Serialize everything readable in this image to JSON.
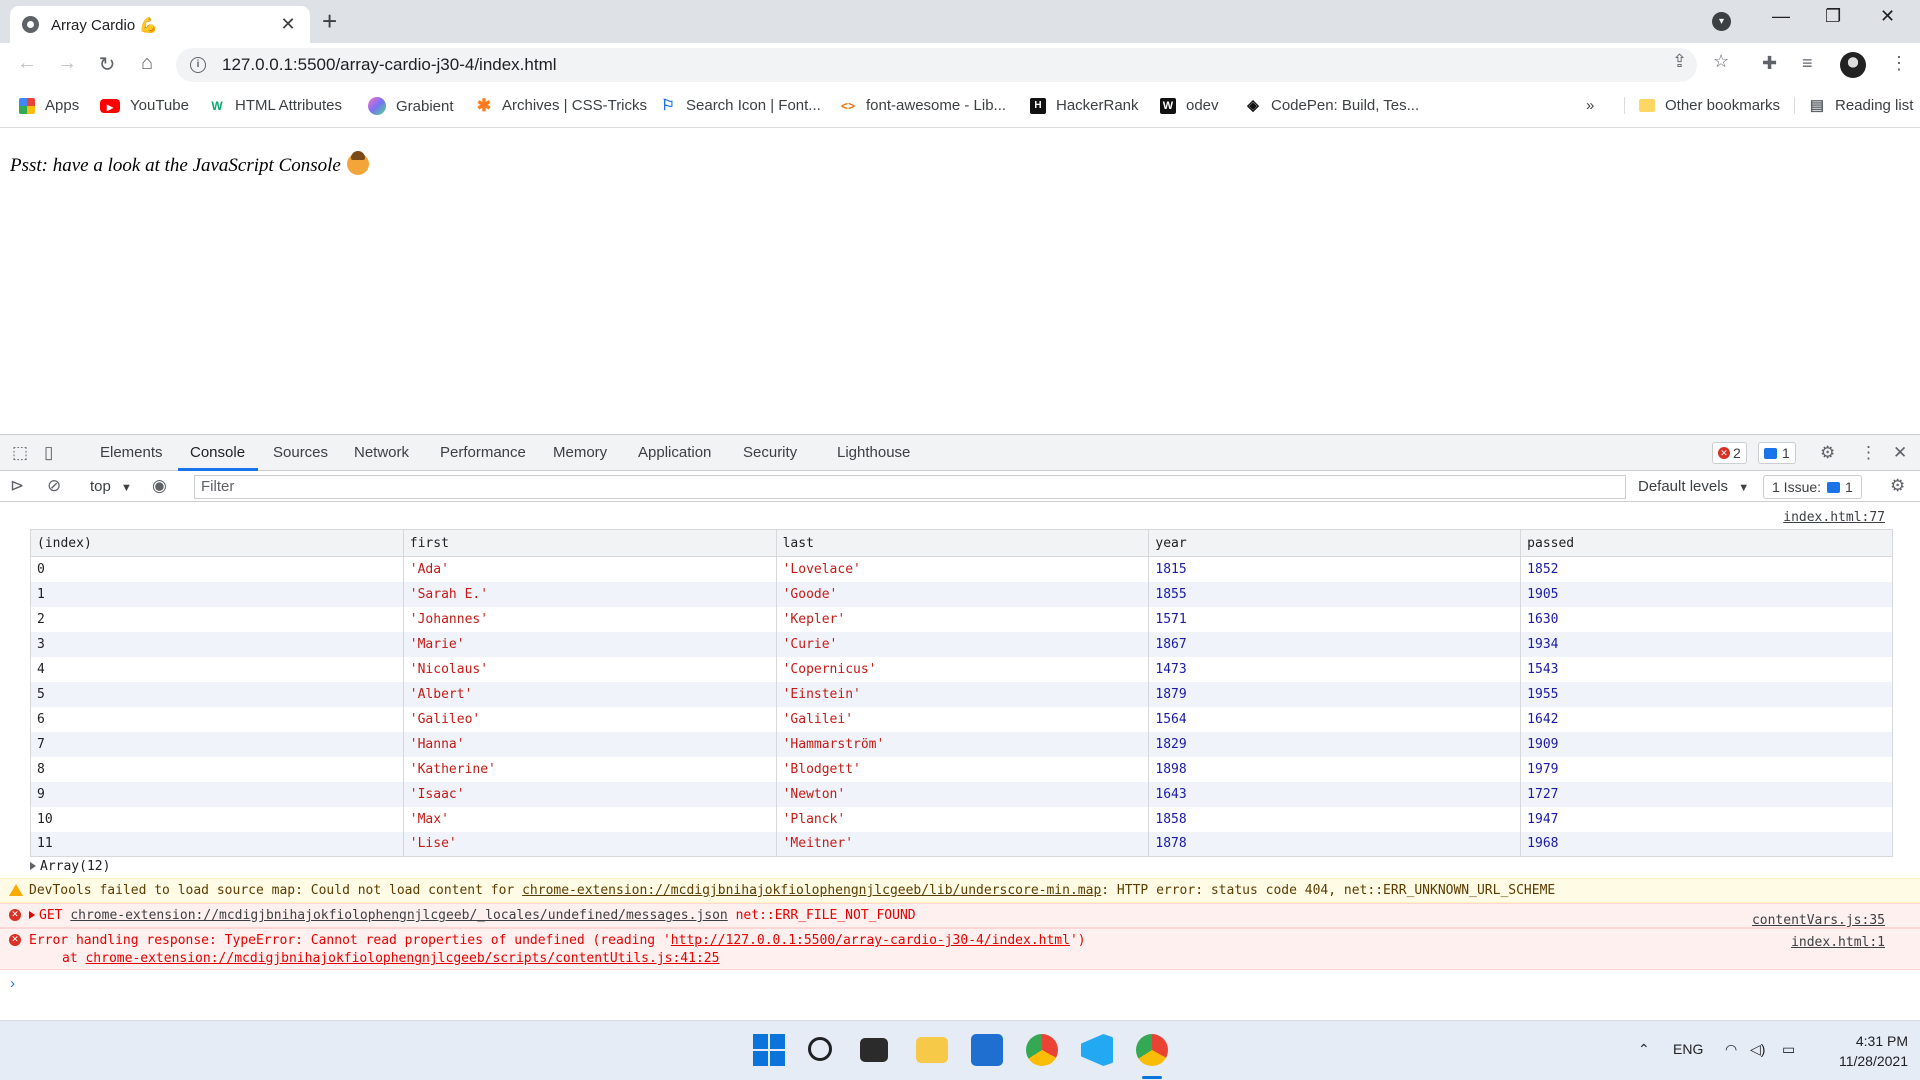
{
  "browser": {
    "tab_title": "Array Cardio 💪",
    "url": "127.0.0.1:5500/array-cardio-j30-4/index.html",
    "bookmarks": [
      {
        "label": "Apps",
        "icon": "apps-grid-icon",
        "color": "#1a73e8"
      },
      {
        "label": "YouTube",
        "icon": "youtube-icon",
        "color": "#ff0000"
      },
      {
        "label": "HTML Attributes",
        "icon": "w3schools-icon",
        "color": "#04aa6d"
      },
      {
        "label": "Grabient",
        "icon": "grabient-icon",
        "color": "#a66cff"
      },
      {
        "label": "Archives | CSS-Tricks",
        "icon": "css-tricks-icon",
        "color": "#ff7a18"
      },
      {
        "label": "Search Icon | Font...",
        "icon": "flag-icon",
        "color": "#1a73e8"
      },
      {
        "label": "font-awesome - Lib...",
        "icon": "code-icon",
        "color": "#e8710a"
      },
      {
        "label": "HackerRank",
        "icon": "hackerrank-icon",
        "color": "#111111"
      },
      {
        "label": "odev",
        "icon": "w-icon",
        "color": "#111111"
      },
      {
        "label": "CodePen: Build, Tes...",
        "icon": "codepen-icon",
        "color": "#111111"
      }
    ],
    "more": "»",
    "other_bookmarks": "Other bookmarks",
    "reading_list": "Reading list"
  },
  "page": {
    "message": "Psst: have a look at the JavaScript Console"
  },
  "devtools": {
    "tabs": [
      "Elements",
      "Console",
      "Sources",
      "Network",
      "Performance",
      "Memory",
      "Application",
      "Security",
      "Lighthouse"
    ],
    "active_tab": "Console",
    "error_count": "2",
    "info_count": "1",
    "context": "top",
    "filter_placeholder": "Filter",
    "levels": "Default levels",
    "issues": "1 Issue:",
    "issues_count": "1"
  },
  "console": {
    "table_source": "index.html:77",
    "table_headers": [
      "(index)",
      "first",
      "last",
      "year",
      "passed"
    ],
    "rows": [
      [
        "0",
        "'Ada'",
        "'Lovelace'",
        "1815",
        "1852"
      ],
      [
        "1",
        "'Sarah E.'",
        "'Goode'",
        "1855",
        "1905"
      ],
      [
        "2",
        "'Johannes'",
        "'Kepler'",
        "1571",
        "1630"
      ],
      [
        "3",
        "'Marie'",
        "'Curie'",
        "1867",
        "1934"
      ],
      [
        "4",
        "'Nicolaus'",
        "'Copernicus'",
        "1473",
        "1543"
      ],
      [
        "5",
        "'Albert'",
        "'Einstein'",
        "1879",
        "1955"
      ],
      [
        "6",
        "'Galileo'",
        "'Galilei'",
        "1564",
        "1642"
      ],
      [
        "7",
        "'Hanna'",
        "'Hammarström'",
        "1829",
        "1909"
      ],
      [
        "8",
        "'Katherine'",
        "'Blodgett'",
        "1898",
        "1979"
      ],
      [
        "9",
        "'Isaac'",
        "'Newton'",
        "1643",
        "1727"
      ],
      [
        "10",
        "'Max'",
        "'Planck'",
        "1858",
        "1947"
      ],
      [
        "11",
        "'Lise'",
        "'Meitner'",
        "1878",
        "1968"
      ]
    ],
    "array_summary": "Array(12)",
    "warning": {
      "prefix": "DevTools failed to load source map: Could not load content for ",
      "link": "chrome-extension://mcdigjbnihajokfiolophengnjlcgeeb/lib/underscore-min.map",
      "suffix": ": HTTP error: status code 404, net::ERR_UNKNOWN_URL_SCHEME"
    },
    "error1": {
      "method": "GET",
      "link": "chrome-extension://mcdigjbnihajokfiolophengnjlcgeeb/_locales/undefined/messages.json",
      "suffix": " net::ERR_FILE_NOT_FOUND",
      "source": "contentVars.js:35"
    },
    "error2": {
      "prefix": "Error handling response: TypeError: Cannot read properties of undefined (reading '",
      "link": "http://127.0.0.1:5500/array-cardio-j30-4/index.html",
      "suffix": "')",
      "at": "at ",
      "at_link": "chrome-extension://mcdigjbnihajokfiolophengnjlcgeeb/scripts/contentUtils.js:41:25",
      "source": "index.html:1"
    },
    "prompt": "›"
  },
  "taskbar": {
    "lang": "ENG",
    "time": "4:31 PM",
    "date": "11/28/2021"
  }
}
